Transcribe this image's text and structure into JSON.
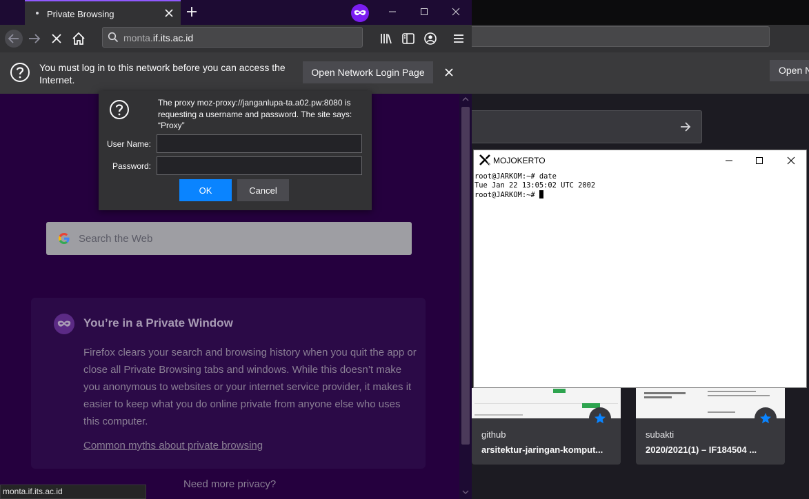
{
  "browser": {
    "tab_title": "Private Browsing",
    "url_prefix": "monta.",
    "url_domain": "if.its.ac.id",
    "status_text": "monta.if.its.ac.id"
  },
  "notification": {
    "message": "You must log in to this network before you can access the Internet.",
    "button_label": "Open Network Login Page"
  },
  "auth_dialog": {
    "message": "The proxy moz-proxy://janganlupa-ta.a02.pw:8080 is requesting a username and password. The site says: “Proxy”",
    "username_label": "User Name:",
    "password_label": "Password:",
    "username_value": "",
    "password_value": "",
    "ok_label": "OK",
    "cancel_label": "Cancel"
  },
  "private_page": {
    "search_placeholder": "Search the Web",
    "title": "You’re in a Private Window",
    "body": "Firefox clears your search and browsing history when you quit the app or close all Private Browsing tabs and windows. While this doesn’t make you anonymous to websites or your internet service provider, it makes it easier to keep what you do online private from anyone else who uses this computer.",
    "link": "Common myths about private browsing",
    "more_privacy": "Need more privacy?"
  },
  "background_window": {
    "notif_button_label": "Open N",
    "tiles": [
      {
        "host": "github",
        "title": "arsitektur-jaringan-komput..."
      },
      {
        "host": "subakti",
        "title": "2020/2021(1) – IF184504 ..."
      }
    ]
  },
  "terminal": {
    "title": "MOJOKERTO",
    "lines": [
      "root@JARKOM:~# date",
      "Tue Jan 22 13:05:02 UTC 2002",
      "root@JARKOM:~# "
    ]
  },
  "colors": {
    "accent": "#0a84ff",
    "private_purple": "#7b1df2",
    "page_bg": "#25003e"
  }
}
